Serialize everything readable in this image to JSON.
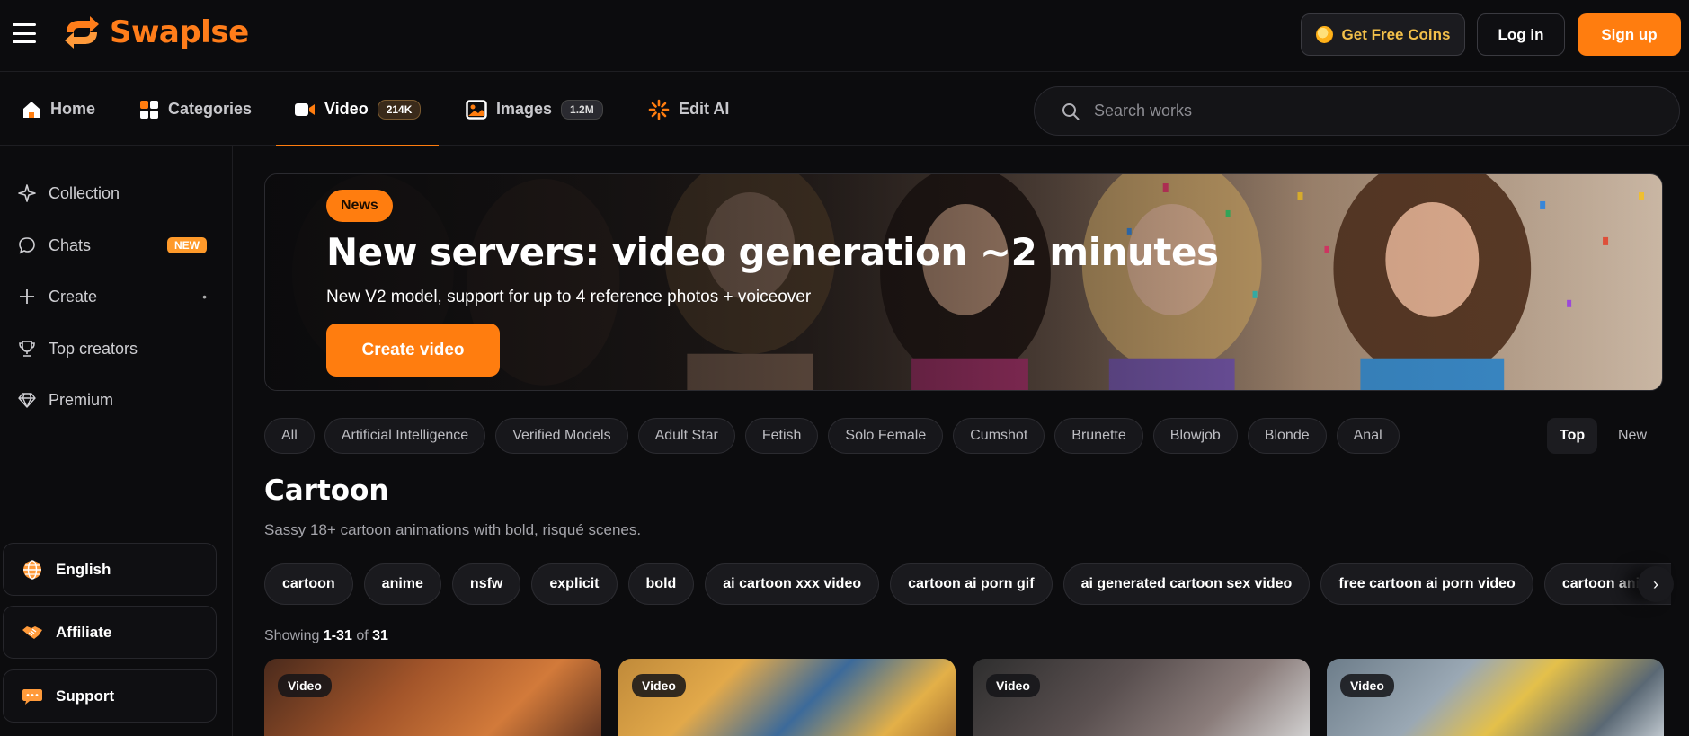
{
  "header": {
    "logo_text": "Swaplse",
    "coins_label": "Get Free Coins",
    "login_label": "Log in",
    "signup_label": "Sign up"
  },
  "nav": {
    "items": [
      {
        "label": "Home",
        "icon": "home-icon"
      },
      {
        "label": "Categories",
        "icon": "grid-icon"
      },
      {
        "label": "Video",
        "badge": "214K",
        "icon": "video-camera-icon",
        "active": true
      },
      {
        "label": "Images",
        "badge": "1.2M",
        "icon": "image-icon"
      },
      {
        "label": "Edit AI",
        "icon": "spinner-icon"
      }
    ],
    "search_placeholder": "Search works"
  },
  "sidebar": {
    "items": [
      {
        "label": "Collection",
        "icon": "sparkle-icon"
      },
      {
        "label": "Chats",
        "icon": "chat-bubble-icon",
        "badge": "NEW"
      },
      {
        "label": "Create",
        "icon": "plus-icon"
      },
      {
        "label": "Top creators",
        "icon": "trophy-icon"
      },
      {
        "label": "Premium",
        "icon": "diamond-icon"
      }
    ],
    "bottom": [
      {
        "label": "English",
        "icon": "globe-icon"
      },
      {
        "label": "Affiliate",
        "icon": "handshake-icon"
      },
      {
        "label": "Support",
        "icon": "support-bubble-icon"
      }
    ]
  },
  "banner": {
    "pill": "News",
    "title": "New servers: video generation ~2 minutes",
    "subtitle": "New V2 model, support for up to 4 reference photos + voiceover",
    "cta": "Create video"
  },
  "filters": [
    "All",
    "Artificial Intelligence",
    "Verified Models",
    "Adult Star",
    "Fetish",
    "Solo Female",
    "Cumshot",
    "Brunette",
    "Blowjob",
    "Blonde",
    "Anal"
  ],
  "sort": {
    "top": "Top",
    "new": "New"
  },
  "section": {
    "title": "Cartoon",
    "description": "Sassy 18+ cartoon animations with bold, risqué scenes.",
    "tags": [
      "cartoon",
      "anime",
      "nsfw",
      "explicit",
      "bold",
      "ai cartoon xxx video",
      "cartoon ai porn gif",
      "ai generated cartoon sex video",
      "free cartoon ai porn video",
      "cartoon animated"
    ],
    "showing_prefix": "Showing",
    "showing_range": "1-31",
    "showing_of": "of",
    "showing_total": "31"
  },
  "cards": [
    {
      "badge": "Video"
    },
    {
      "badge": "Video"
    },
    {
      "badge": "Video"
    },
    {
      "badge": "Video"
    }
  ],
  "colors": {
    "accent": "#ff7d0f",
    "background": "#0c0c0e",
    "coin_text": "#f3c04a"
  }
}
